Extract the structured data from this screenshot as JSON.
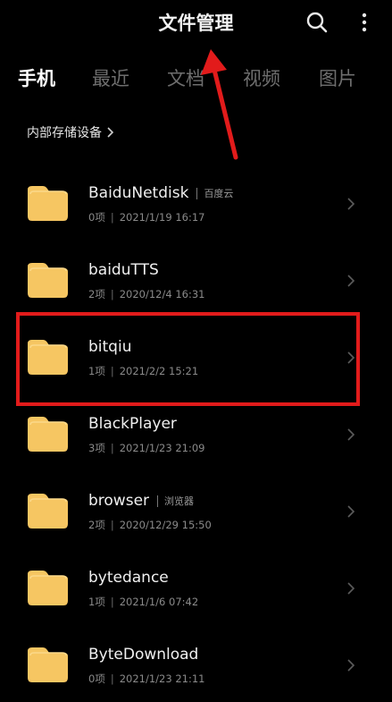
{
  "header": {
    "title": "文件管理"
  },
  "tabs": [
    {
      "label": "手机",
      "active": true
    },
    {
      "label": "最近",
      "active": false
    },
    {
      "label": "文档",
      "active": false
    },
    {
      "label": "视频",
      "active": false
    },
    {
      "label": "图片",
      "active": false
    }
  ],
  "breadcrumb": {
    "label": "内部存储设备"
  },
  "folders": [
    {
      "name": "BaiduNetdisk",
      "tag": "百度云",
      "count": "0项",
      "date": "2021/1/19 16:17"
    },
    {
      "name": "baiduTTS",
      "tag": "",
      "count": "2项",
      "date": "2020/12/4 16:31"
    },
    {
      "name": "bitqiu",
      "tag": "",
      "count": "1项",
      "date": "2021/2/2 15:21"
    },
    {
      "name": "BlackPlayer",
      "tag": "",
      "count": "3项",
      "date": "2021/1/23 21:09"
    },
    {
      "name": "browser",
      "tag": "浏览器",
      "count": "2项",
      "date": "2020/12/29 15:50"
    },
    {
      "name": "bytedance",
      "tag": "",
      "count": "1项",
      "date": "2021/1/6 07:42"
    },
    {
      "name": "ByteDownload",
      "tag": "",
      "count": "0项",
      "date": "2021/1/23 21:11"
    }
  ],
  "meta_separator": "|",
  "colors": {
    "background": "#000000",
    "folder": "#f6c662",
    "annotation": "#e21b1b"
  },
  "icons": {
    "search": "search-icon",
    "more": "more-vertical-icon",
    "folder": "folder-icon",
    "chevron": "chevron-right-icon"
  }
}
